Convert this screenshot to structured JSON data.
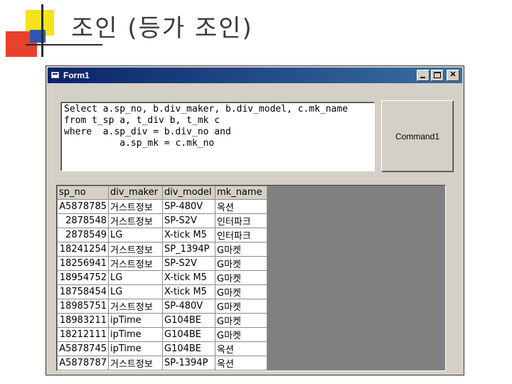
{
  "slide": {
    "title": "조인 (등가 조인)"
  },
  "window": {
    "title": "Form1",
    "buttons": {
      "minimize": "minimize",
      "maximize": "maximize",
      "close": "✕"
    }
  },
  "sql_text": "Select a.sp_no, b.div_maker, b.div_model, c.mk_name\nfrom t_sp a, t_div b, t_mk c\nwhere  a.sp_div = b.div_no and\n          a.sp_mk = c.mk_no",
  "command_button": {
    "label": "Command1"
  },
  "grid": {
    "columns": [
      "sp_no",
      "div_maker",
      "div_model",
      "mk_name"
    ],
    "rows": [
      [
        "A5878785",
        "거스트정보",
        "SP-480V",
        "옥션"
      ],
      [
        "2878548",
        "거스트정보",
        "SP-S2V",
        "인터파크"
      ],
      [
        "2878549",
        "LG",
        "X-tick M5",
        "인터파크"
      ],
      [
        "18241254",
        "거스트정보",
        "SP_1394P",
        "G마켓"
      ],
      [
        "18256941",
        "거스트정보",
        "SP-S2V",
        "G마켓"
      ],
      [
        "18954752",
        "LG",
        "X-tick M5",
        "G마켓"
      ],
      [
        "18758454",
        "LG",
        "X-tick M5",
        "G마켓"
      ],
      [
        "18985751",
        "거스트정보",
        "SP-480V",
        "G마켓"
      ],
      [
        "18983211",
        "ipTime",
        "G104BE",
        "G마켓"
      ],
      [
        "18212111",
        "ipTime",
        "G104BE",
        "G마켓"
      ],
      [
        "A5878745",
        "ipTime",
        "G104BE",
        "옥션"
      ],
      [
        "A5878787",
        "거스트정보",
        "SP-1394P",
        "옥션"
      ]
    ]
  }
}
